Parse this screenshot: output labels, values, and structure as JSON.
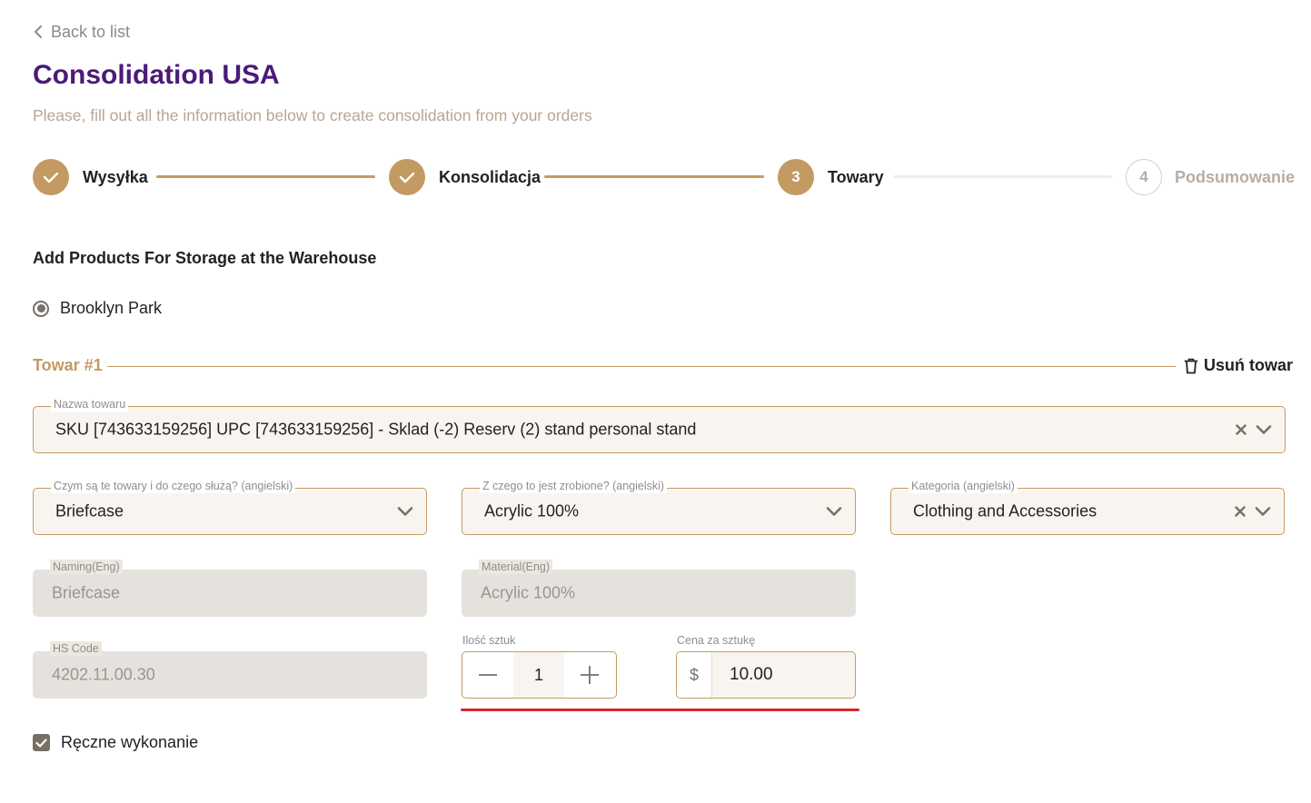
{
  "back": {
    "label": "Back to list"
  },
  "page": {
    "title": "Consolidation USA",
    "subtitle": "Please, fill out all the information below to create consolidation from your orders"
  },
  "steps": [
    {
      "label": "Wysyłka",
      "state": "done",
      "number": "1"
    },
    {
      "label": "Konsolidacja",
      "state": "done",
      "number": "2"
    },
    {
      "label": "Towary",
      "state": "active",
      "number": "3"
    },
    {
      "label": "Podsumowanie",
      "state": "todo",
      "number": "4"
    }
  ],
  "section": {
    "heading": "Add Products For Storage at the Warehouse",
    "warehouse_option": "Brooklyn Park"
  },
  "item": {
    "title": "Towar #1",
    "remove_label": "Usuń towar",
    "product": {
      "label": "Nazwa towaru",
      "value": "SKU [743633159256] UPC [743633159256] - Sklad (-2) Reserv (2) stand personal stand"
    },
    "what_is_it": {
      "label": "Czym są te towary i do czego służą? (angielski)",
      "value": "Briefcase"
    },
    "material": {
      "label": "Z czego to jest zrobione? (angielski)",
      "value": "Acrylic 100%"
    },
    "category": {
      "label": "Kategoria (angielski)",
      "value": "Clothing and Accessories"
    },
    "naming_eng": {
      "label": "Naming(Eng)",
      "value": "Briefcase"
    },
    "material_eng": {
      "label": "Material(Eng)",
      "value": "Acrylic 100%"
    },
    "hs_code": {
      "label": "HS Code",
      "value": "4202.11.00.30"
    },
    "quantity": {
      "label": "Ilość sztuk",
      "value": "1"
    },
    "price": {
      "label": "Cena za sztukę",
      "currency": "$",
      "value": "10.00"
    },
    "handmade": {
      "label": "Ręczne wykonanie",
      "checked": true
    }
  },
  "colors": {
    "accent": "#c49a63",
    "title": "#4b1a7a",
    "highlight_underline": "#d9262e"
  },
  "icons": [
    "chevron-left-icon",
    "check-icon",
    "trash-icon",
    "clear-icon",
    "chevron-down-icon",
    "minus-icon",
    "plus-icon"
  ]
}
